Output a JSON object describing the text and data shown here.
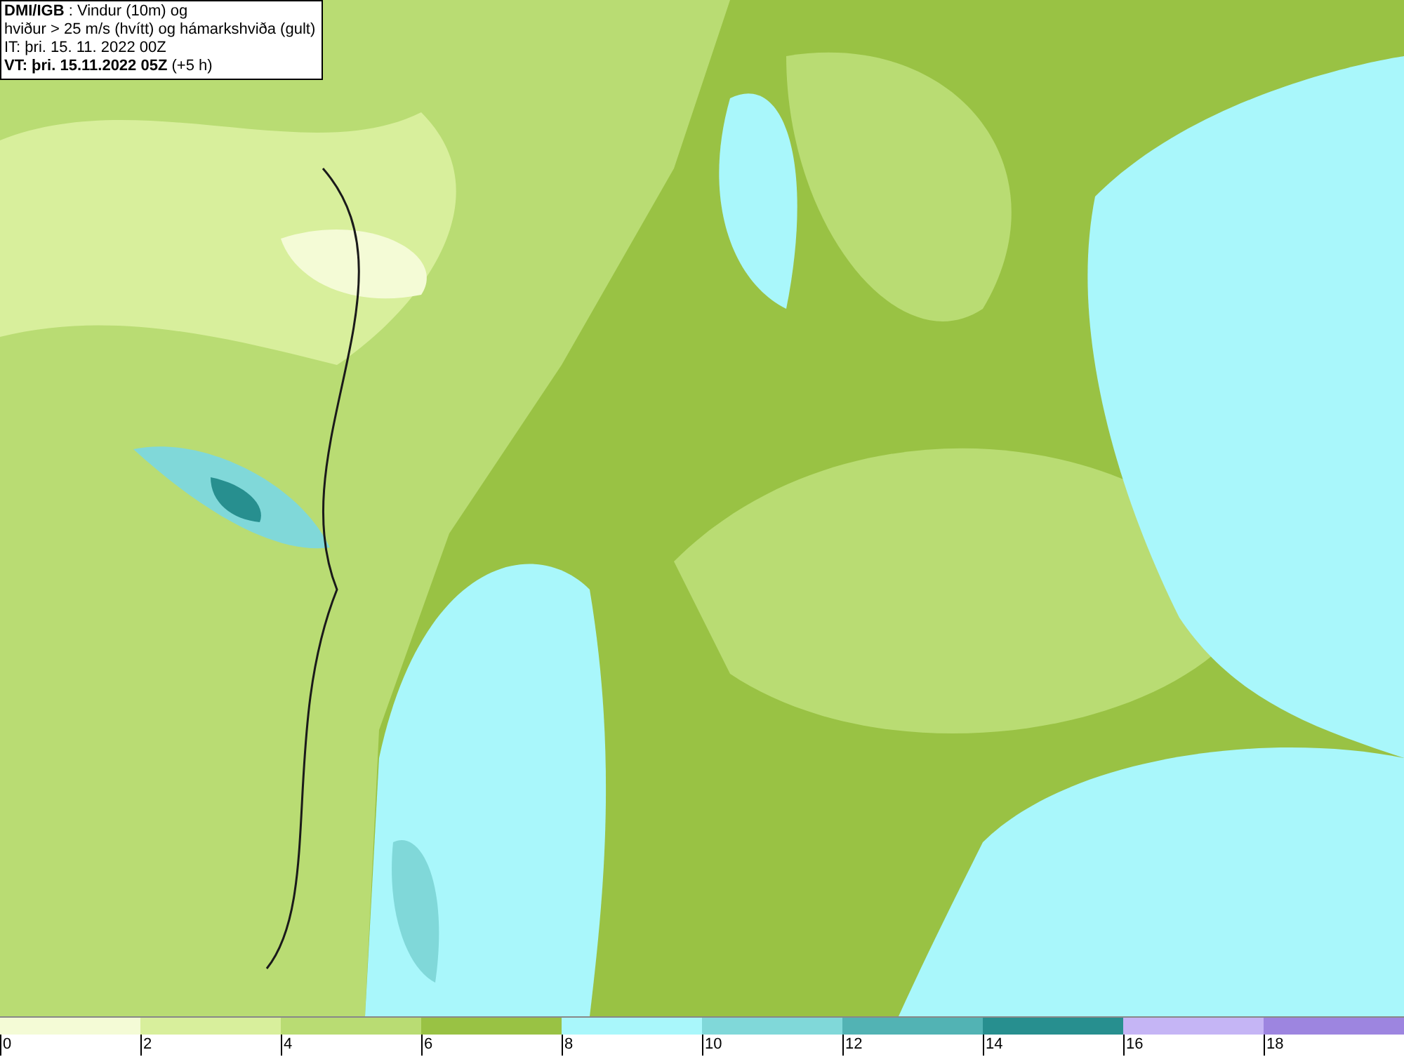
{
  "title_box": {
    "lines": [
      "**DMI/IGB** : Vindur (10m) og",
      "hviður > 25 m/s (hvítt) og hámarkshviða (gult)",
      "IT: þri. 15. 11. 2022 00Z",
      "**VT: þri. 15.11.2022 05Z** (+5 h)"
    ]
  },
  "legend": {
    "segments": [
      {
        "label": "0",
        "color": "#f4fbd6"
      },
      {
        "label": "2",
        "color": "#d8ef9c"
      },
      {
        "label": "4",
        "color": "#b9dc73"
      },
      {
        "label": "6",
        "color": "#99c244"
      },
      {
        "label": "8",
        "color": "#a9f7fb"
      },
      {
        "label": "10",
        "color": "#80d8d9"
      },
      {
        "label": "12",
        "color": "#52b3b4"
      },
      {
        "label": "14",
        "color": "#278f8f"
      },
      {
        "label": "16",
        "color": "#c5b5f5"
      },
      {
        "label": "18",
        "color": "#9d85e0"
      }
    ]
  }
}
